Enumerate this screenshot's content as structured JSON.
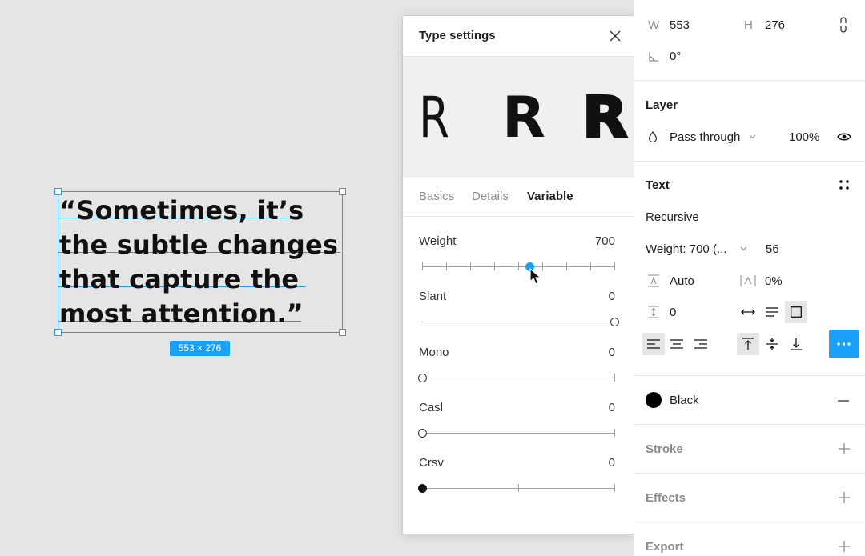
{
  "canvas": {
    "text_lines": [
      "“Sometimes, it’s",
      "the subtle changes",
      "that capture the",
      "most attention.”"
    ],
    "size_badge": "553 × 276"
  },
  "type_settings": {
    "title": "Type settings",
    "preview_glyphs": [
      "R",
      "R",
      "R"
    ],
    "tabs": [
      {
        "label": "Basics",
        "active": false
      },
      {
        "label": "Details",
        "active": false
      },
      {
        "label": "Variable",
        "active": true
      }
    ],
    "axes": [
      {
        "label": "Weight",
        "value": "700",
        "level": 0.56
      },
      {
        "label": "Slant",
        "value": "0",
        "level": 1.0
      },
      {
        "label": "Mono",
        "value": "0",
        "level": 0.0
      },
      {
        "label": "Casl",
        "value": "0",
        "level": 0.0
      },
      {
        "label": "Crsv",
        "value": "0",
        "level": 0.0
      }
    ]
  },
  "properties": {
    "w_label": "W",
    "w_value": "553",
    "h_label": "H",
    "h_value": "276",
    "rotation": "0°",
    "layer": {
      "title": "Layer",
      "blend_mode": "Pass through",
      "opacity": "100%"
    },
    "text": {
      "title": "Text",
      "font_family": "Recursive",
      "font_weight": "Weight: 700 (...",
      "font_size": "56",
      "line_height": "Auto",
      "letter_spacing": "0%",
      "paragraph_spacing": "0"
    },
    "fill": {
      "color_name": "Black",
      "color": "#000000"
    },
    "stroke_title": "Stroke",
    "effects_title": "Effects",
    "export_title": "Export"
  },
  "colors": {
    "accent": "#18a0fb"
  }
}
